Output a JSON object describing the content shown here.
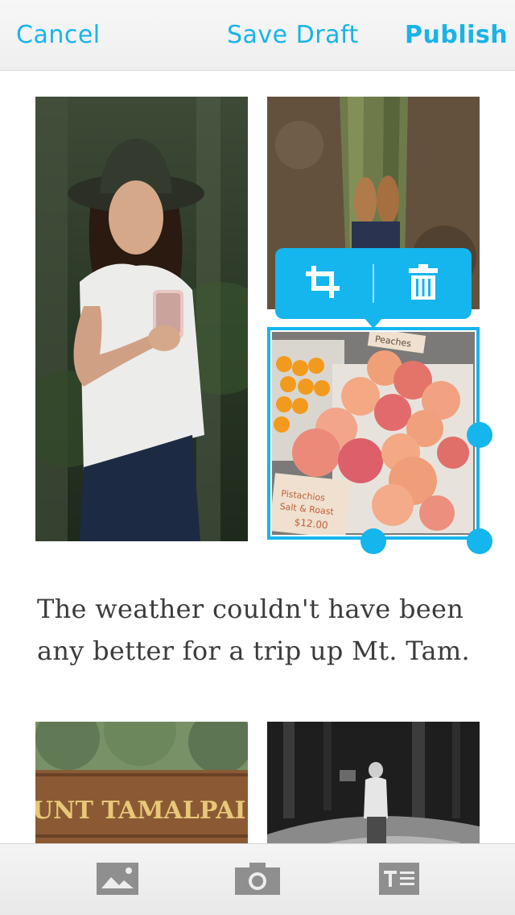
{
  "nav": {
    "cancel_label": "Cancel",
    "save_draft_label": "Save Draft",
    "publish_label": "Publish"
  },
  "colors": {
    "accent": "#15b5ee",
    "nav_text": "#1ab3e8",
    "body_text": "#3b3b3b",
    "toolbar_icon": "#8f8f8f"
  },
  "photos": [
    {
      "name": "woman-with-phone-photo"
    },
    {
      "name": "mossy-log-boots-photo"
    },
    {
      "name": "peaches-market-photo",
      "selected": true,
      "crate_labels": [
        "Peaches",
        "Pistachios Salt & Roast",
        "$12.00"
      ]
    },
    {
      "name": "mount-tamalpais-sign-photo",
      "sign_text": "UNT TAMALPAI"
    },
    {
      "name": "forest-hiker-bw-photo"
    }
  ],
  "popover": {
    "crop_icon": "crop-icon",
    "delete_icon": "trash-icon"
  },
  "caption": {
    "line1": "The weather couldn't have been",
    "line2": "any better for a trip up Mt. Tam."
  },
  "toolbar": {
    "items": [
      {
        "icon": "image-icon"
      },
      {
        "icon": "camera-icon"
      },
      {
        "icon": "text-icon"
      }
    ]
  }
}
